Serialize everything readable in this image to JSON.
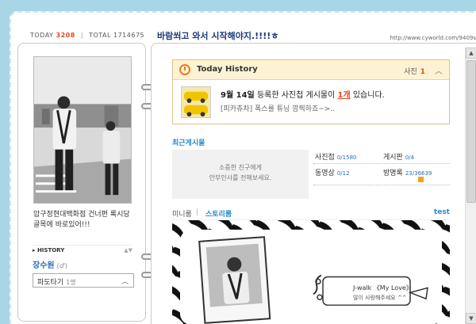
{
  "counter": {
    "today_label": "TODAY",
    "today_value": "3208",
    "total_label": "TOTAL",
    "total_value": "1714675"
  },
  "header": {
    "title": "바람쐬고 와서 시작해야지.!!!!ㅎ",
    "url": "http://www.cyworld.com/9409s"
  },
  "profile": {
    "text": "압구정현대백화점 건너편 록시당골목에 바로있어!!!",
    "history_label": "HISTORY",
    "owner_name": "장수원",
    "gender": "(♂)",
    "paddo": {
      "label": "파도타기",
      "count": "1명"
    }
  },
  "today_history": {
    "title": "Today History",
    "photo_label": "사진",
    "photo_count": "1",
    "notice_date": "9월 14일",
    "notice_mid": "등록한 사진첩 게시물이",
    "notice_count": "1개",
    "notice_end": "있습니다.",
    "sub": "[피카츄차] 폭스를 튜닝 깜찍하죠~>.."
  },
  "recent": {
    "label": "최근게시물",
    "greeting_line1": "소중한 친구에게",
    "greeting_line2": "안부인사를 전해보세요.",
    "stats": [
      {
        "label": "사진첩",
        "value": "0/1580"
      },
      {
        "label": "게시판",
        "value": "0/4"
      },
      {
        "label": "동영상",
        "value": "0/12"
      },
      {
        "label": "방명록",
        "value": "23/36639"
      }
    ]
  },
  "tabs": {
    "minirum": "미니룸",
    "divider": "|",
    "story": "스토리룸",
    "test": "test"
  },
  "storyroom": {
    "line1": "J-walk 《My Love》",
    "line2": "많이 사랑해주세요 ^^"
  },
  "colors": {
    "accent_blue": "#2a88c9",
    "highlight_red": "#e24a1f",
    "background": "#a9d6e5"
  }
}
